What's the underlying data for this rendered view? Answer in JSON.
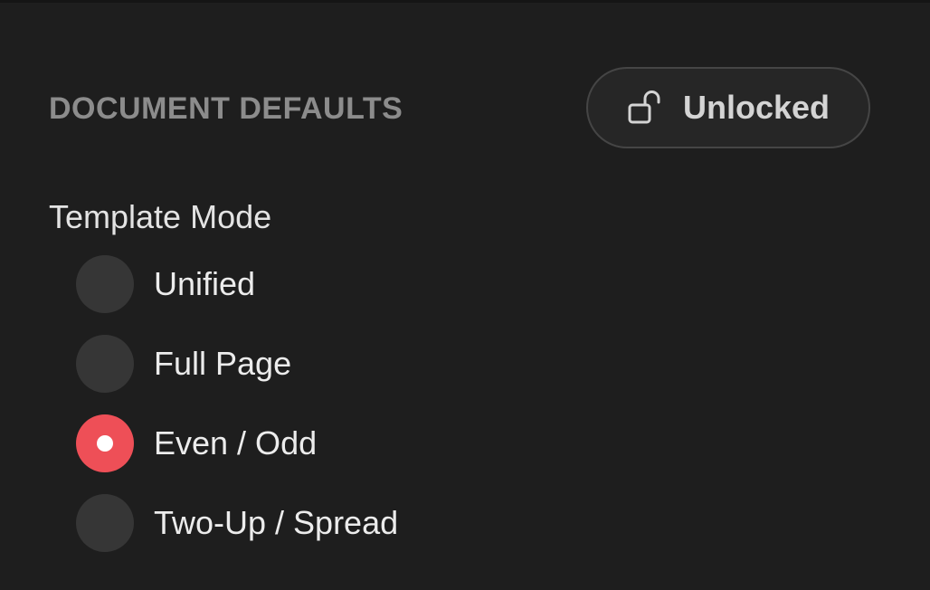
{
  "panel": {
    "section_title": "DOCUMENT DEFAULTS",
    "lock_button": {
      "label": "Unlocked",
      "icon": "unlocked-padlock-icon"
    }
  },
  "template_mode": {
    "label": "Template Mode",
    "options": [
      {
        "label": "Unified",
        "selected": false
      },
      {
        "label": "Full Page",
        "selected": false
      },
      {
        "label": "Even / Odd",
        "selected": true
      },
      {
        "label": "Two-Up / Spread",
        "selected": false
      }
    ],
    "selected_value": "Even / Odd"
  },
  "colors": {
    "background": "#1e1e1e",
    "accent": "#ee4f57",
    "radio_unselected": "#363636",
    "header_text": "#8c8c8c"
  }
}
